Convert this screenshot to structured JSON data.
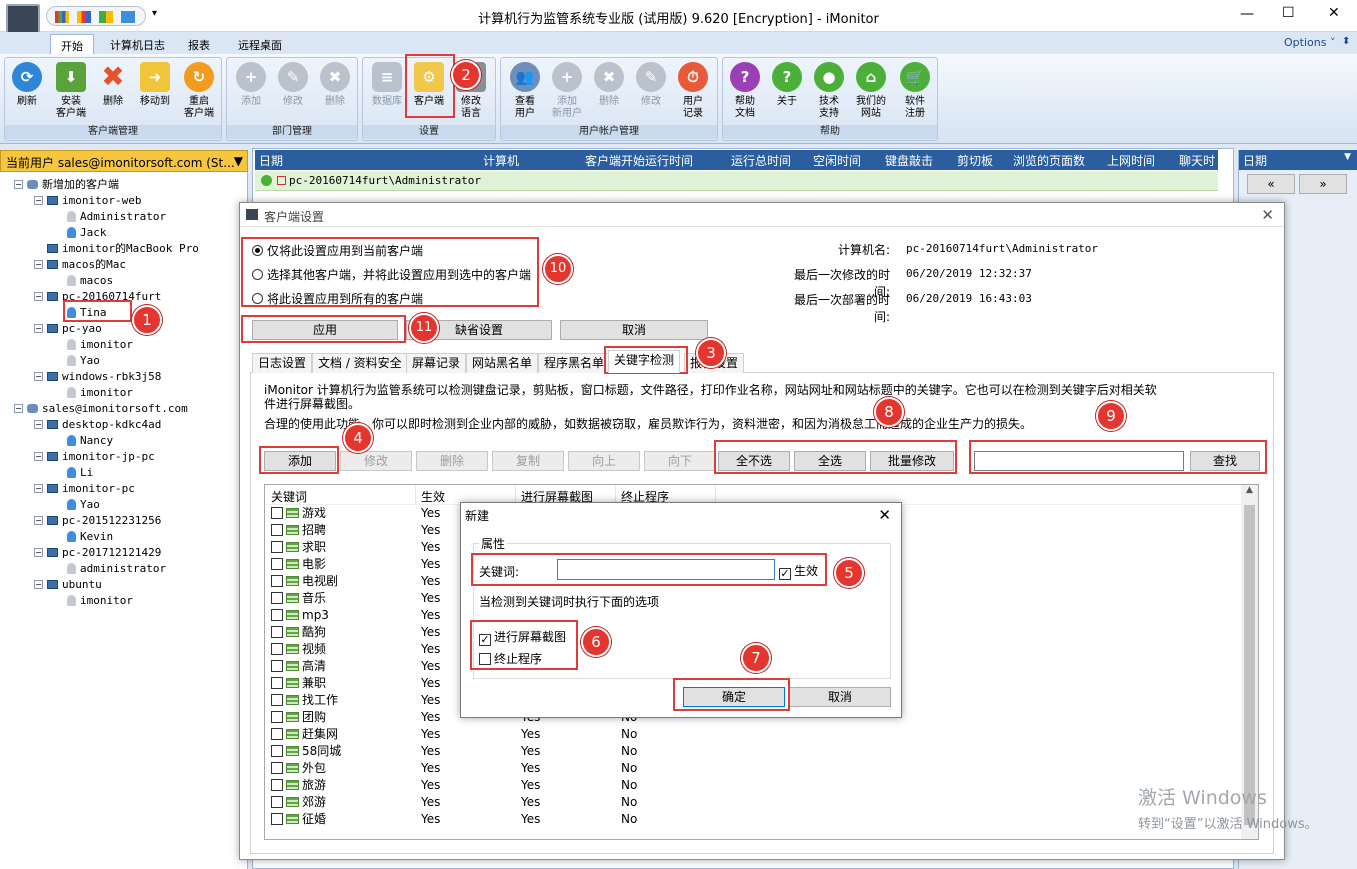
{
  "window": {
    "title": "计算机行为监管系统专业版 (试用版) 9.620 [Encryption] - iMonitor",
    "options": "Options ˅",
    "min": "—",
    "max": "☐",
    "close": "✕"
  },
  "tabs": [
    "开始",
    "计算机日志",
    "报表",
    "远程桌面"
  ],
  "ribbon": {
    "client_group": "客户端管理",
    "client_btns": [
      "刷新",
      "安装\n客户端",
      "删除",
      "移动到",
      "重启\n客户端"
    ],
    "dept_group": "部门管理",
    "dept_btns": [
      "添加",
      "修改",
      "删除"
    ],
    "settings_group": "设置",
    "settings_btns": [
      "数据库",
      "客户端",
      "修改\n语言"
    ],
    "account_group": "用户帐户管理",
    "account_btns": [
      "查看\n用户",
      "添加\n新用户",
      "删除",
      "修改",
      "用户\n记录"
    ],
    "help_group": "帮助",
    "help_btns": [
      "帮助\n文档",
      "关于",
      "技术\n支持",
      "我们的\n网站",
      "软件\n注册"
    ]
  },
  "sidebar": {
    "header": "当前用户  sales@imonitorsoft.com (St...",
    "tree": [
      {
        "d": 0,
        "k": "grp",
        "t": "新增加的客户端",
        "m": "⊟"
      },
      {
        "d": 1,
        "k": "pc",
        "t": "imonitor-web",
        "m": "⊟"
      },
      {
        "d": 2,
        "k": "usrg",
        "t": "Administrator"
      },
      {
        "d": 2,
        "k": "usr",
        "t": "Jack"
      },
      {
        "d": 1,
        "k": "pc",
        "t": "imonitor的MacBook Pro"
      },
      {
        "d": 1,
        "k": "pc",
        "t": "macos的Mac",
        "m": "⊟"
      },
      {
        "d": 2,
        "k": "usrg",
        "t": "macos"
      },
      {
        "d": 1,
        "k": "pc",
        "t": "pc-20160714furt",
        "m": "⊟"
      },
      {
        "d": 2,
        "k": "usr",
        "t": "Tina"
      },
      {
        "d": 1,
        "k": "pc",
        "t": "pc-yao",
        "m": "⊟"
      },
      {
        "d": 2,
        "k": "usrg",
        "t": "imonitor"
      },
      {
        "d": 2,
        "k": "usrg",
        "t": "Yao"
      },
      {
        "d": 1,
        "k": "pc",
        "t": "windows-rbk3j58",
        "m": "⊟"
      },
      {
        "d": 2,
        "k": "usrg",
        "t": "imonitor"
      },
      {
        "d": 0,
        "k": "grp",
        "t": "sales@imonitorsoft.com",
        "m": "⊟"
      },
      {
        "d": 1,
        "k": "pc",
        "t": "desktop-kdkc4ad",
        "m": "⊟"
      },
      {
        "d": 2,
        "k": "usr",
        "t": "Nancy"
      },
      {
        "d": 1,
        "k": "pc",
        "t": "imonitor-jp-pc",
        "m": "⊟"
      },
      {
        "d": 2,
        "k": "usr",
        "t": "Li"
      },
      {
        "d": 1,
        "k": "pc",
        "t": "imonitor-pc",
        "m": "⊟"
      },
      {
        "d": 2,
        "k": "usr",
        "t": "Yao"
      },
      {
        "d": 1,
        "k": "pc",
        "t": "pc-201512231256",
        "m": "⊟"
      },
      {
        "d": 2,
        "k": "usr",
        "t": "Kevin"
      },
      {
        "d": 1,
        "k": "pc",
        "t": "pc-201712121429",
        "m": "⊟"
      },
      {
        "d": 2,
        "k": "usrg",
        "t": "administrator"
      },
      {
        "d": 1,
        "k": "pc",
        "t": "ubuntu",
        "m": "⊟"
      },
      {
        "d": 2,
        "k": "usrg",
        "t": "imonitor"
      }
    ]
  },
  "grid": {
    "headers": [
      "日期",
      "计算机",
      "客户端开始运行时间",
      "运行总时间",
      "空闲时间",
      "键盘敲击",
      "剪切板",
      "浏览的页面数",
      "上网时间",
      "聊天时"
    ],
    "row1": "pc-20160714furt\\Administrator"
  },
  "right_panel": {
    "title": "日期",
    "prev": "«",
    "next": "»"
  },
  "dialog": {
    "title": "客户端设置",
    "radio1": "仅将此设置应用到当前客户端",
    "radio2": "选择其他客户端，并将此设置应用到选中的客户端",
    "radio3": "将此设置应用到所有的客户端",
    "computer_label": "计算机名:",
    "computer_value": "pc-20160714furt\\Administrator",
    "modified_label": "最后一次修改的时间:",
    "modified_value": "06/20/2019 12:32:37",
    "deployed_label": "最后一次部署的时间:",
    "deployed_value": "06/20/2019 16:43:03",
    "apply": "应用",
    "default": "缺省设置",
    "cancel": "取消",
    "tabs": [
      "日志设置",
      "文档 / 资料安全",
      "屏幕记录",
      "网站黑名单",
      "程序黑名单",
      "关键字检测",
      "报警设置"
    ],
    "desc1": "iMonitor 计算机行为监管系统可以检测键盘记录，剪贴板，窗口标题，文件路径，打印作业名称，网站网址和网站标题中的关键字。它也可以在检测到关键字后对相关软",
    "desc2": "件进行屏幕截图。",
    "desc3": "合理的使用此功能，你可以即时检测到企业内部的威胁，如数据被窃取，雇员欺诈行为，资料泄密，和因为消极怠工而造成的企业生产力的损失。",
    "btn_add": "添加",
    "btn_edit": "修改",
    "btn_del": "删除",
    "btn_copy": "复制",
    "btn_up": "向上",
    "btn_down": "向下",
    "btn_none": "全不选",
    "btn_all": "全选",
    "btn_batch": "批量修改",
    "btn_find": "查找",
    "search_value": "",
    "list_headers": [
      "关键词",
      "生效",
      "进行屏幕截图",
      "终止程序"
    ],
    "keywords": [
      {
        "w": "游戏",
        "e": "Yes",
        "s": "Yes",
        "t": "No"
      },
      {
        "w": "招聘",
        "e": "Yes",
        "s": "Yes",
        "t": "No"
      },
      {
        "w": "求职",
        "e": "Yes",
        "s": "Yes",
        "t": "No"
      },
      {
        "w": "电影",
        "e": "Yes",
        "s": "Yes",
        "t": "No"
      },
      {
        "w": "电视剧",
        "e": "Yes",
        "s": "Yes",
        "t": "No"
      },
      {
        "w": "音乐",
        "e": "Yes",
        "s": "Yes",
        "t": "No"
      },
      {
        "w": "mp3",
        "e": "Yes",
        "s": "Yes",
        "t": "No"
      },
      {
        "w": "酷狗",
        "e": "Yes",
        "s": "Yes",
        "t": "No"
      },
      {
        "w": "视频",
        "e": "Yes",
        "s": "Yes",
        "t": "No"
      },
      {
        "w": "高清",
        "e": "Yes",
        "s": "Yes",
        "t": "No"
      },
      {
        "w": "兼职",
        "e": "Yes",
        "s": "Yes",
        "t": "No"
      },
      {
        "w": "找工作",
        "e": "Yes",
        "s": "Yes",
        "t": "No"
      },
      {
        "w": "团购",
        "e": "Yes",
        "s": "Yes",
        "t": "No"
      },
      {
        "w": "赶集网",
        "e": "Yes",
        "s": "Yes",
        "t": "No"
      },
      {
        "w": "58同城",
        "e": "Yes",
        "s": "Yes",
        "t": "No"
      },
      {
        "w": "外包",
        "e": "Yes",
        "s": "Yes",
        "t": "No"
      },
      {
        "w": "旅游",
        "e": "Yes",
        "s": "Yes",
        "t": "No"
      },
      {
        "w": "郊游",
        "e": "Yes",
        "s": "Yes",
        "t": "No"
      },
      {
        "w": "征婚",
        "e": "Yes",
        "s": "Yes",
        "t": "No"
      }
    ]
  },
  "new_dialog": {
    "title": "新建",
    "props": "属性",
    "kw_label": "关键词:",
    "kw_value": "",
    "enabled": "生效",
    "hint": "当检测到关键词时执行下面的选项",
    "screenshot": "进行屏幕截图",
    "terminate": "终止程序",
    "ok": "确定",
    "cancel": "取消"
  },
  "badges": [
    "1",
    "2",
    "3",
    "4",
    "5",
    "6",
    "7",
    "8",
    "9",
    "10",
    "11"
  ],
  "watermark": {
    "line1": "激活 Windows",
    "line2": "转到“设置”以激活 Windows。"
  }
}
